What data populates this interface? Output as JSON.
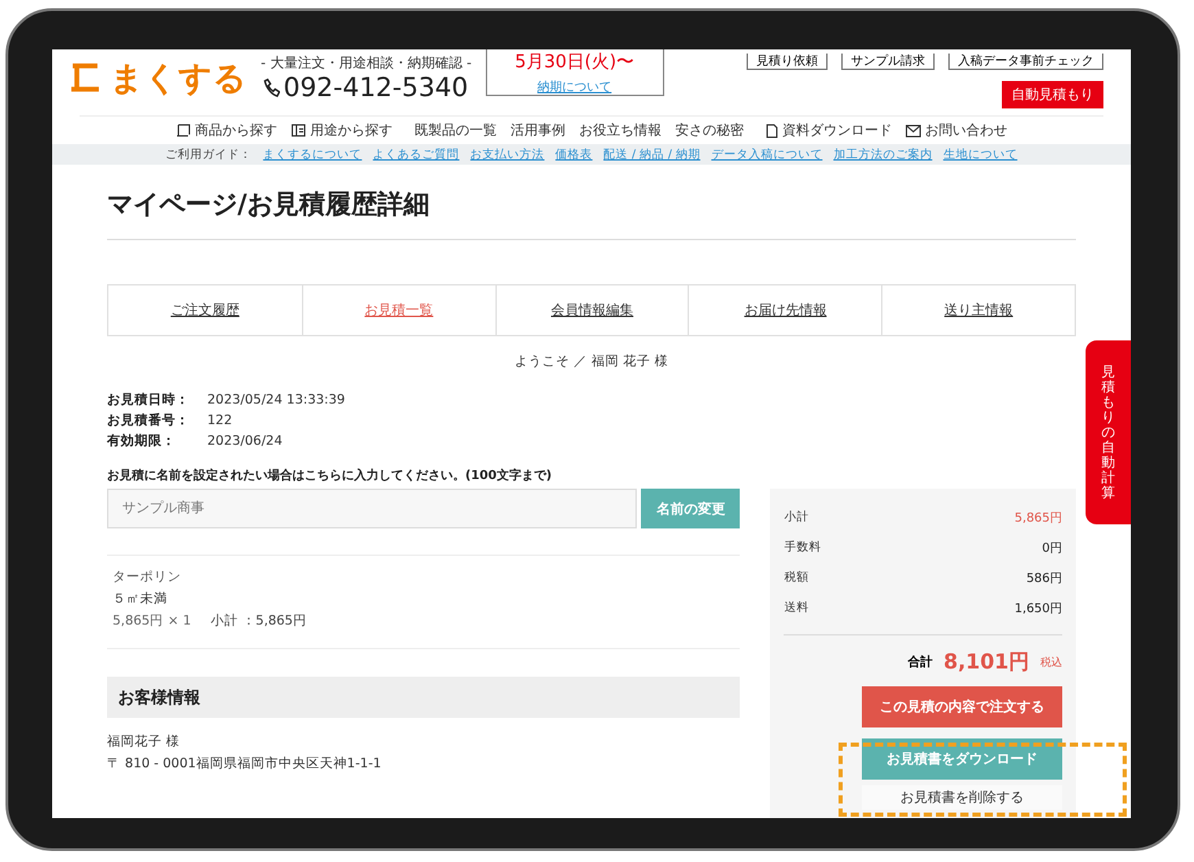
{
  "header": {
    "logo": "まくする",
    "tagline": "- 大量注文・用途相談・納期確認 -",
    "phone": "092-412-5340",
    "delivery_date": "5月30日(火)〜",
    "delivery_link": "納期について",
    "top_buttons": [
      {
        "label": "見積り依頼"
      },
      {
        "label": "サンプル請求"
      },
      {
        "label": "入稿データ事前チェック"
      }
    ],
    "auto_quote": "自動見積もり"
  },
  "nav": [
    {
      "label": "商品から探す",
      "kind": "icon"
    },
    {
      "label": "用途から探す",
      "kind": "icon"
    },
    {
      "label": "既製品の一覧",
      "kind": "plain"
    },
    {
      "label": "活用事例",
      "kind": "plain"
    },
    {
      "label": "お役立ち情報",
      "kind": "plain"
    },
    {
      "label": "安さの秘密",
      "kind": "plain"
    },
    {
      "label": "資料ダウンロード",
      "kind": "icon"
    },
    {
      "label": "お問い合わせ",
      "kind": "icon"
    }
  ],
  "guide": {
    "label": "ご利用ガイド：",
    "links": [
      "まくするについて",
      "よくあるご質問",
      "お支払い方法",
      "価格表",
      "配送 / 納品 / 納期",
      "データ入稿について",
      "加工方法のご案内",
      "生地について"
    ]
  },
  "page_title": "マイページ/お見積履歴詳細",
  "tabs": [
    {
      "label": "ご注文履歴",
      "selected": false
    },
    {
      "label": "お見積一覧",
      "selected": true
    },
    {
      "label": "会員情報編集",
      "selected": false
    },
    {
      "label": "お届け先情報",
      "selected": false
    },
    {
      "label": "送り主情報",
      "selected": false
    }
  ],
  "welcome": "ようこそ ／ 福岡 花子 様",
  "info": [
    {
      "label": "お見積日時：",
      "value": "2023/05/24 13:33:39"
    },
    {
      "label": "お見積番号：",
      "value": "122"
    },
    {
      "label": "有効期限：",
      "value": "2023/06/24"
    }
  ],
  "name_form": {
    "instruction": "お見積に名前を設定されたい場合はこちらに入力してください。(100文字まで)",
    "placeholder": "サンプル商事",
    "button": "名前の変更"
  },
  "item": {
    "name": "ターポリン",
    "size": "５㎡未満",
    "price": "5,865円 × 1",
    "subtotal": "小計 ：5,865円"
  },
  "customer": {
    "heading": "お客様情報",
    "name": "福岡花子 様",
    "address": "〒 810 - 0001福岡県福岡市中央区天神1-1-1"
  },
  "summary": {
    "rows": [
      {
        "label": "小計",
        "value": "5,865円",
        "highlight": true
      },
      {
        "label": "手数料",
        "value": "0円",
        "highlight": false
      },
      {
        "label": "税額",
        "value": "586円",
        "highlight": false
      },
      {
        "label": "送料",
        "value": "1,650円",
        "highlight": false
      }
    ],
    "total_label": "合計",
    "total": "8,101円",
    "tax_note": "税込",
    "order_button": "この見積の内容で注文する",
    "download_button": "お見積書をダウンロード",
    "delete_button": "お見積書を削除する"
  },
  "side_tab": "見積もりの自動計算"
}
